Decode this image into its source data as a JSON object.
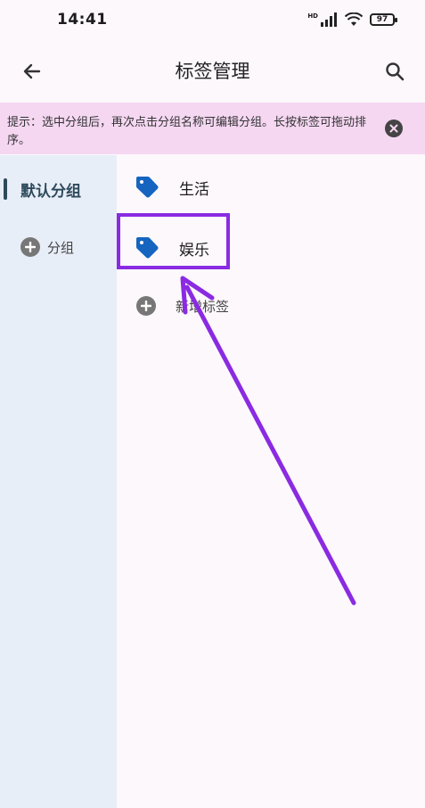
{
  "status_bar": {
    "time": "14:41",
    "battery": "97",
    "network": "HD"
  },
  "app_bar": {
    "title": "标签管理",
    "back_icon": "arrow-left-icon",
    "search_icon": "search-icon"
  },
  "tip": {
    "text": "提示：选中分组后，再次点击分组名称可编辑分组。长按标签可拖动排序。",
    "close_icon": "close-circle-icon"
  },
  "sidebar": {
    "groups": [
      {
        "label": "默认分组",
        "selected": true
      }
    ],
    "add_group_label": "分组"
  },
  "tags": [
    {
      "label": "生活",
      "icon": "tag-icon"
    },
    {
      "label": "娱乐",
      "icon": "tag-icon"
    }
  ],
  "new_tag_label": "新增标签",
  "colors": {
    "accent": "#8a2be2",
    "tag_icon": "#1565c0",
    "banner": "#f5d7f2",
    "sidebar": "#e8eef8"
  }
}
